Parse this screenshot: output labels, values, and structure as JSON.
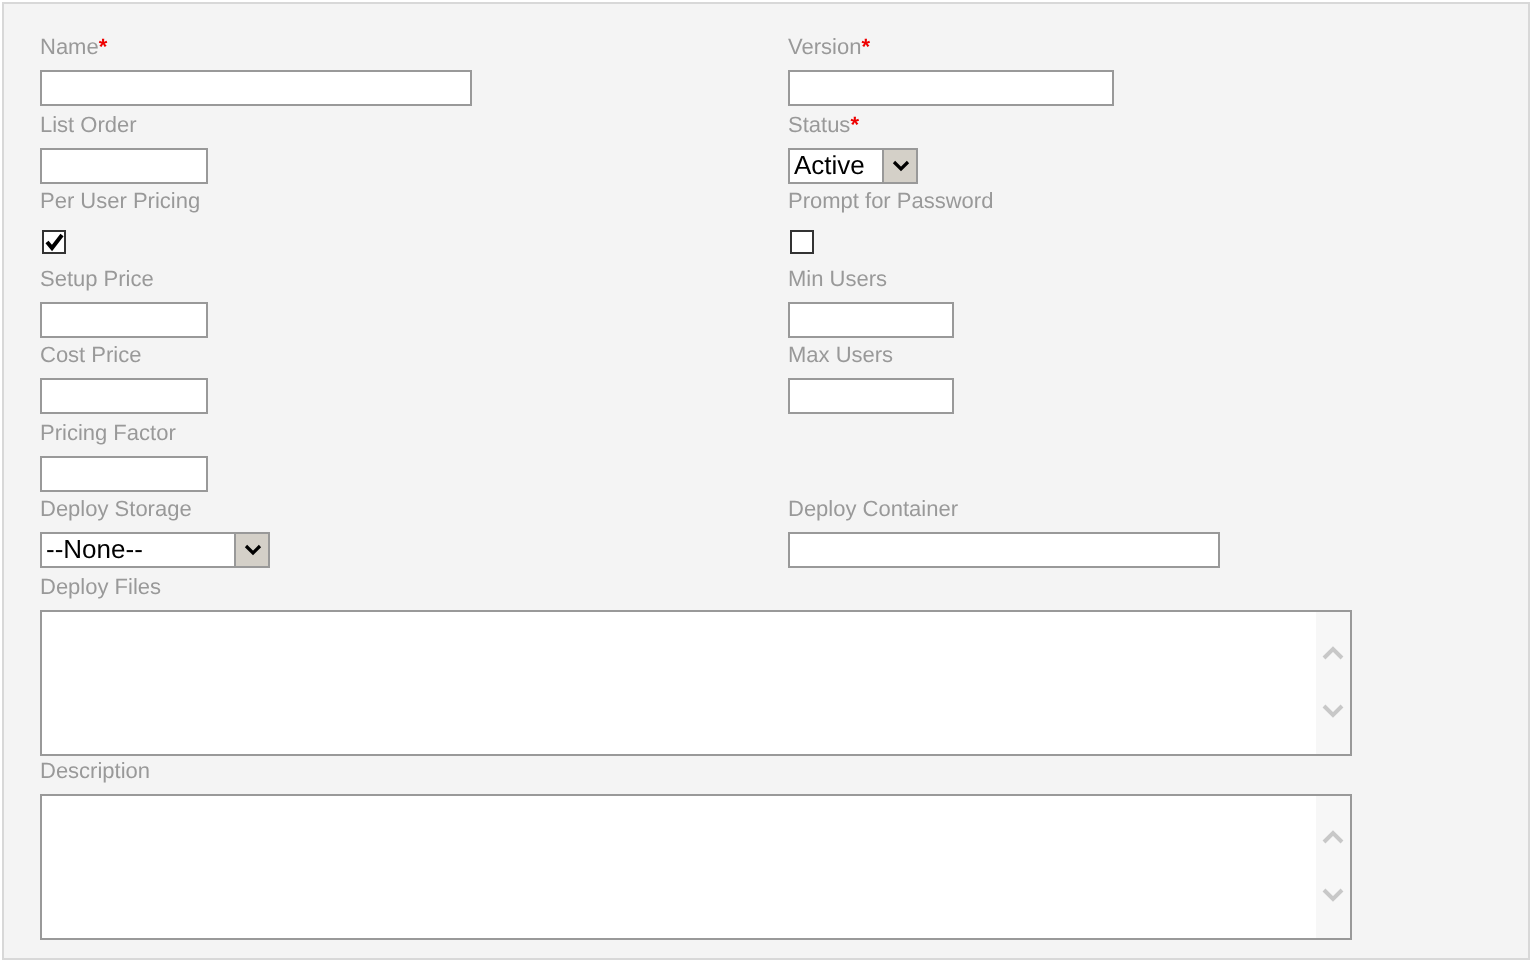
{
  "rows": [
    {
      "left": {
        "kind": "text",
        "label": "Name",
        "required_mark": "*"
      },
      "right": {
        "kind": "text",
        "label": "Version",
        "required_mark": "*"
      }
    },
    {
      "left": {
        "kind": "text",
        "label": "List Order"
      },
      "right": {
        "kind": "select",
        "label": "Status",
        "required_mark": "*",
        "value": "Active"
      }
    },
    {
      "left": {
        "kind": "checkbox",
        "label": "Per User Pricing",
        "checked": true
      },
      "right": {
        "kind": "checkbox",
        "label": "Prompt for Password",
        "checked": false
      }
    },
    {
      "left": {
        "kind": "text",
        "label": "Setup Price"
      },
      "right": {
        "kind": "text",
        "label": "Min Users"
      }
    },
    {
      "left": {
        "kind": "text",
        "label": "Cost Price"
      },
      "right": {
        "kind": "text",
        "label": "Max Users"
      }
    },
    {
      "left": {
        "kind": "text",
        "label": "Pricing Factor"
      }
    },
    {
      "left": {
        "kind": "select",
        "label": "Deploy Storage",
        "value": "--None--"
      },
      "right": {
        "kind": "text",
        "label": "Deploy Container"
      }
    },
    {
      "left": {
        "kind": "textarea",
        "label": "Deploy Files"
      }
    },
    {
      "left": {
        "kind": "textarea",
        "label": "Description"
      }
    }
  ]
}
